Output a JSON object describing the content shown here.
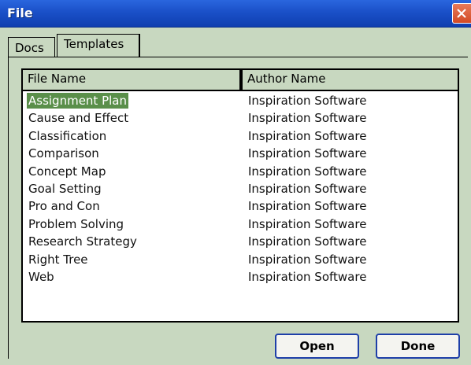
{
  "window": {
    "title": "File",
    "close_icon": "close-icon"
  },
  "tabs": [
    {
      "label": "Docs",
      "active": false
    },
    {
      "label": "Templates",
      "active": true
    }
  ],
  "list": {
    "columns": [
      "File Name",
      "Author Name"
    ],
    "rows": [
      {
        "name": "Assignment Plan",
        "author": "Inspiration Software",
        "selected": true
      },
      {
        "name": "Cause and Effect",
        "author": "Inspiration Software"
      },
      {
        "name": "Classification",
        "author": "Inspiration Software"
      },
      {
        "name": "Comparison",
        "author": "Inspiration Software"
      },
      {
        "name": "Concept Map",
        "author": "Inspiration Software"
      },
      {
        "name": "Goal Setting",
        "author": "Inspiration Software"
      },
      {
        "name": "Pro and Con",
        "author": "Inspiration Software"
      },
      {
        "name": "Problem Solving",
        "author": "Inspiration Software"
      },
      {
        "name": "Research Strategy",
        "author": "Inspiration Software"
      },
      {
        "name": "Right Tree",
        "author": "Inspiration Software"
      },
      {
        "name": "Web",
        "author": "Inspiration Software"
      }
    ]
  },
  "buttons": {
    "open": "Open",
    "done": "Done"
  },
  "colors": {
    "titlebar": "#1a50c8",
    "background": "#c8d8c0",
    "selection": "#5a8f4a",
    "close": "#d34a24"
  }
}
